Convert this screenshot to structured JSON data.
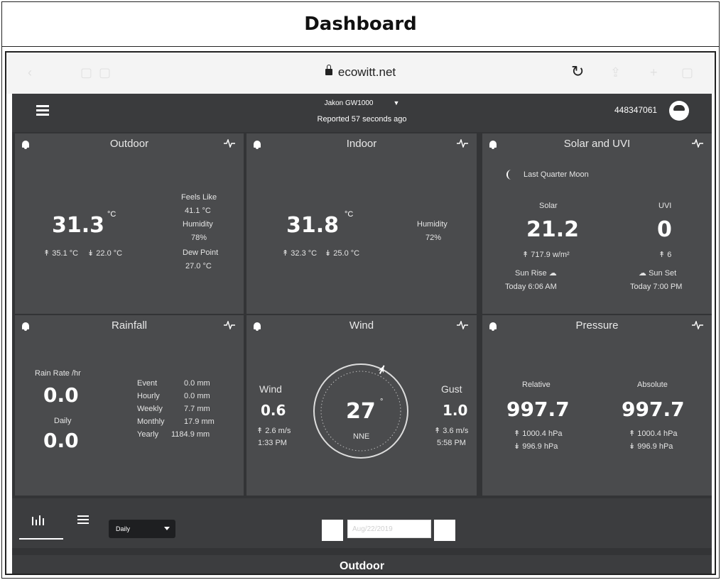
{
  "page": {
    "title": "Dashboard"
  },
  "browser": {
    "url": "ecowitt.net"
  },
  "header": {
    "device": "Jakon GW1000",
    "reported": "Reported 57 seconds ago",
    "user_id": "448347061"
  },
  "outdoor": {
    "title": "Outdoor",
    "temp": "31.3",
    "unit": "°C",
    "high": "↟ 35.1 °C",
    "low": "↡ 22.0 °C",
    "feels_like_label": "Feels Like",
    "feels_like": "41.1 °C",
    "humidity_label": "Humidity",
    "humidity": "78%",
    "dew_point_label": "Dew Point",
    "dew_point": "27.0 °C"
  },
  "indoor": {
    "title": "Indoor",
    "temp": "31.8",
    "unit": "°C",
    "high": "↟ 32.3 °C",
    "low": "↡ 25.0 °C",
    "humidity_label": "Humidity",
    "humidity": "72%"
  },
  "solar": {
    "title": "Solar and UVI",
    "moon": "Last Quarter Moon",
    "solar_label": "Solar",
    "solar_value": "21.2",
    "solar_max": "↟ 717.9 w/m²",
    "uvi_label": "UVI",
    "uvi_value": "0",
    "uvi_max": "↟ 6",
    "sunrise_label": "Sun Rise",
    "sunrise_time": "Today 6:06 AM",
    "sunset_label": "Sun Set",
    "sunset_time": "Today 7:00 PM"
  },
  "rainfall": {
    "title": "Rainfall",
    "rate_label": "Rain Rate /hr",
    "rate": "0.0",
    "daily_label": "Daily",
    "daily": "0.0",
    "rows": [
      {
        "label": "Event",
        "value": "0.0 mm"
      },
      {
        "label": "Hourly",
        "value": "0.0 mm"
      },
      {
        "label": "Weekly",
        "value": "7.7 mm"
      },
      {
        "label": "Monthly",
        "value": "17.9 mm"
      },
      {
        "label": "Yearly",
        "value": "1184.9 mm"
      }
    ]
  },
  "wind": {
    "title": "Wind",
    "wind_label": "Wind",
    "wind_value": "0.6",
    "wind_max": "↟ 2.6 m/s",
    "wind_time": "1:33 PM",
    "direction": "27",
    "direction_unit": "°",
    "direction_name": "NNE",
    "direction_degrees": 27,
    "gust_label": "Gust",
    "gust_value": "1.0",
    "gust_max": "↟ 3.6 m/s",
    "gust_time": "5:58 PM"
  },
  "pressure": {
    "title": "Pressure",
    "relative_label": "Relative",
    "relative": "997.7",
    "relative_high": "↟ 1000.4 hPa",
    "relative_low": "↡ 996.9 hPa",
    "absolute_label": "Absolute",
    "absolute": "997.7",
    "absolute_high": "↟ 1000.4 hPa",
    "absolute_low": "↡ 996.9 hPa"
  },
  "toolbar": {
    "period": "Daily",
    "date": "Aug/22/2019"
  },
  "section": {
    "title": "Outdoor"
  },
  "colors": {
    "background": "#333436",
    "card": "#4a4b4d",
    "text": "#ffffff"
  }
}
